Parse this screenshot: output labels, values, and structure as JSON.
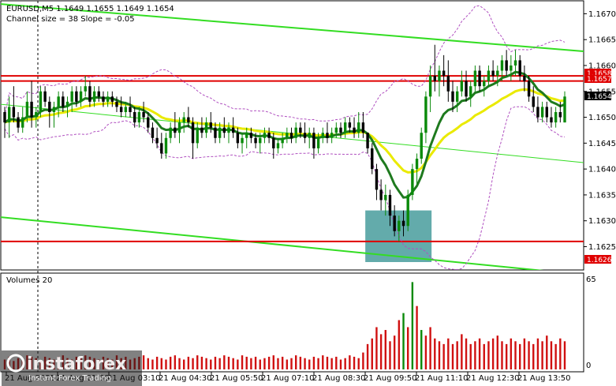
{
  "chart_data": [
    {
      "type": "candlestick",
      "title": "EURUSD,M5  1.1649 1.1655 1.1649 1.1654",
      "subtitle": "Channel size = 38 Slope = -0.05",
      "ylim": [
        1.16205,
        1.16725
      ],
      "y_ticks": [
        1.167,
        1.1665,
        1.166,
        1.1655,
        1.165,
        1.1645,
        1.164,
        1.1635,
        1.163,
        1.1625
      ],
      "x_labels": [
        "21 Aug 2025",
        "21 Aug 01:50",
        "21 Aug 03:10",
        "21 Aug 04:30",
        "21 Aug 05:50",
        "21 Aug 07:10",
        "21 Aug 08:30",
        "21 Aug 09:50",
        "21 Aug 11:10",
        "21 Aug 12:30",
        "21 Aug 13:50"
      ],
      "price_tags": {
        "resistance": "1.1658",
        "mid": "1.1657",
        "current": "1.1654",
        "support": "1.1626"
      },
      "levels": {
        "resistance": 1.1658,
        "mid": 1.1657,
        "support": 1.1626
      },
      "colors": {
        "up": "#0a8a0a",
        "down": "#000000",
        "level": "#e00000",
        "channel": "#33dd22",
        "ma_slow": "#eaea00",
        "ma_fast": "#1e7a1e",
        "band": "#b050c0",
        "highlight": "#3c9696",
        "volume": "#d01010",
        "volume_up": "#0a8a0a"
      },
      "ohlc": [
        [
          1.1651,
          1.1652,
          1.1646,
          1.1649
        ],
        [
          1.1649,
          1.1654,
          1.1646,
          1.1652
        ],
        [
          1.1652,
          1.1656,
          1.1649,
          1.165
        ],
        [
          1.165,
          1.1651,
          1.1647,
          1.1648
        ],
        [
          1.1648,
          1.1652,
          1.1647,
          1.165
        ],
        [
          1.165,
          1.1655,
          1.1649,
          1.1653
        ],
        [
          1.1653,
          1.1657,
          1.1648,
          1.165
        ],
        [
          1.165,
          1.1652,
          1.1648,
          1.1651
        ],
        [
          1.1651,
          1.1656,
          1.165,
          1.1655
        ],
        [
          1.1655,
          1.1656,
          1.1652,
          1.1653
        ],
        [
          1.1653,
          1.1654,
          1.1648,
          1.1651
        ],
        [
          1.1651,
          1.1653,
          1.1648,
          1.1652
        ],
        [
          1.1652,
          1.1655,
          1.165,
          1.1654
        ],
        [
          1.1654,
          1.1655,
          1.1651,
          1.1652
        ],
        [
          1.1652,
          1.1654,
          1.165,
          1.1653
        ],
        [
          1.1653,
          1.1656,
          1.1651,
          1.1655
        ],
        [
          1.1655,
          1.1656,
          1.1652,
          1.1653
        ],
        [
          1.1653,
          1.1656,
          1.1652,
          1.1655
        ],
        [
          1.1655,
          1.1658,
          1.1654,
          1.1656
        ],
        [
          1.1656,
          1.1657,
          1.1652,
          1.1653
        ],
        [
          1.1653,
          1.1656,
          1.1652,
          1.1655
        ],
        [
          1.1655,
          1.1656,
          1.1653,
          1.1654
        ],
        [
          1.1654,
          1.1655,
          1.1652,
          1.1653
        ],
        [
          1.1653,
          1.1655,
          1.1652,
          1.1654
        ],
        [
          1.1654,
          1.1655,
          1.1652,
          1.1653
        ],
        [
          1.1653,
          1.1654,
          1.1651,
          1.1652
        ],
        [
          1.1652,
          1.1654,
          1.165,
          1.1651
        ],
        [
          1.1651,
          1.1653,
          1.165,
          1.1652
        ],
        [
          1.1652,
          1.1654,
          1.165,
          1.1651
        ],
        [
          1.1651,
          1.1652,
          1.1648,
          1.1649
        ],
        [
          1.1649,
          1.1652,
          1.1648,
          1.1651
        ],
        [
          1.1651,
          1.1653,
          1.1649,
          1.165
        ],
        [
          1.165,
          1.1651,
          1.1647,
          1.1648
        ],
        [
          1.1648,
          1.1649,
          1.1645,
          1.1646
        ],
        [
          1.1646,
          1.1648,
          1.1644,
          1.1645
        ],
        [
          1.1645,
          1.1647,
          1.1642,
          1.1643
        ],
        [
          1.1643,
          1.1647,
          1.1642,
          1.1646
        ],
        [
          1.1646,
          1.1649,
          1.1645,
          1.1648
        ],
        [
          1.1648,
          1.1651,
          1.1646,
          1.1647
        ],
        [
          1.1647,
          1.165,
          1.1645,
          1.1649
        ],
        [
          1.1649,
          1.1651,
          1.1647,
          1.165
        ],
        [
          1.165,
          1.1652,
          1.1648,
          1.1649
        ],
        [
          1.1649,
          1.165,
          1.1642,
          1.1645
        ],
        [
          1.1645,
          1.1649,
          1.1644,
          1.1648
        ],
        [
          1.1648,
          1.165,
          1.1646,
          1.1647
        ],
        [
          1.1647,
          1.165,
          1.1646,
          1.1649
        ],
        [
          1.1649,
          1.1651,
          1.1647,
          1.1648
        ],
        [
          1.1648,
          1.1649,
          1.1645,
          1.1646
        ],
        [
          1.1646,
          1.1649,
          1.1645,
          1.1648
        ],
        [
          1.1648,
          1.165,
          1.1646,
          1.1647
        ],
        [
          1.1647,
          1.1649,
          1.1645,
          1.1648
        ],
        [
          1.1648,
          1.165,
          1.1646,
          1.1647
        ],
        [
          1.1647,
          1.1648,
          1.1644,
          1.1645
        ],
        [
          1.1645,
          1.1647,
          1.1643,
          1.1646
        ],
        [
          1.1646,
          1.1648,
          1.1644,
          1.1647
        ],
        [
          1.1647,
          1.1648,
          1.1645,
          1.1646
        ],
        [
          1.1646,
          1.1647,
          1.1644,
          1.1645
        ],
        [
          1.1645,
          1.1647,
          1.1643,
          1.1646
        ],
        [
          1.1646,
          1.1648,
          1.1645,
          1.1647
        ],
        [
          1.1647,
          1.1648,
          1.1645,
          1.1646
        ],
        [
          1.1646,
          1.1647,
          1.1642,
          1.1644
        ],
        [
          1.1644,
          1.1646,
          1.1643,
          1.1645
        ],
        [
          1.1645,
          1.1647,
          1.1644,
          1.1646
        ],
        [
          1.1646,
          1.1648,
          1.1645,
          1.1647
        ],
        [
          1.1647,
          1.1648,
          1.1645,
          1.1646
        ],
        [
          1.1646,
          1.1649,
          1.1645,
          1.1648
        ],
        [
          1.1648,
          1.1649,
          1.1646,
          1.1647
        ],
        [
          1.1647,
          1.1649,
          1.1645,
          1.1646
        ],
        [
          1.1646,
          1.1648,
          1.1644,
          1.1647
        ],
        [
          1.1647,
          1.1648,
          1.1642,
          1.1644
        ],
        [
          1.1644,
          1.1647,
          1.1643,
          1.1646
        ],
        [
          1.1646,
          1.1648,
          1.1645,
          1.1647
        ],
        [
          1.1647,
          1.1649,
          1.1645,
          1.1646
        ],
        [
          1.1646,
          1.1648,
          1.1645,
          1.1647
        ],
        [
          1.1647,
          1.1649,
          1.1646,
          1.1648
        ],
        [
          1.1648,
          1.1649,
          1.1646,
          1.1647
        ],
        [
          1.1647,
          1.165,
          1.1646,
          1.1649
        ],
        [
          1.1649,
          1.165,
          1.1647,
          1.1648
        ],
        [
          1.1648,
          1.165,
          1.1646,
          1.1647
        ],
        [
          1.1647,
          1.1651,
          1.1646,
          1.1649
        ],
        [
          1.1649,
          1.1651,
          1.1646,
          1.1647
        ],
        [
          1.1647,
          1.1646,
          1.1643,
          1.1644
        ],
        [
          1.1644,
          1.1645,
          1.1639,
          1.164
        ],
        [
          1.164,
          1.1641,
          1.1634,
          1.1636
        ],
        [
          1.1636,
          1.1638,
          1.1632,
          1.1634
        ],
        [
          1.1634,
          1.1637,
          1.1631,
          1.1635
        ],
        [
          1.1635,
          1.1636,
          1.1629,
          1.1631
        ],
        [
          1.1631,
          1.1633,
          1.1627,
          1.1628
        ],
        [
          1.1628,
          1.1631,
          1.1626,
          1.163
        ],
        [
          1.163,
          1.1632,
          1.1627,
          1.1629
        ],
        [
          1.1629,
          1.1636,
          1.1628,
          1.1635
        ],
        [
          1.1635,
          1.1641,
          1.1634,
          1.164
        ],
        [
          1.164,
          1.1643,
          1.1637,
          1.1642
        ],
        [
          1.1642,
          1.1648,
          1.1641,
          1.1647
        ],
        [
          1.1647,
          1.1655,
          1.1645,
          1.1654
        ],
        [
          1.1654,
          1.166,
          1.1651,
          1.1658
        ],
        [
          1.1658,
          1.1664,
          1.1655,
          1.1657
        ],
        [
          1.1657,
          1.166,
          1.1654,
          1.1659
        ],
        [
          1.1659,
          1.1662,
          1.1656,
          1.1658
        ],
        [
          1.1658,
          1.1661,
          1.1653,
          1.1655
        ],
        [
          1.1655,
          1.1657,
          1.1651,
          1.1653
        ],
        [
          1.1653,
          1.1656,
          1.1651,
          1.1655
        ],
        [
          1.1655,
          1.1659,
          1.1654,
          1.1657
        ],
        [
          1.1657,
          1.1659,
          1.1653,
          1.1654
        ],
        [
          1.1654,
          1.1657,
          1.1652,
          1.1656
        ],
        [
          1.1656,
          1.166,
          1.1655,
          1.1659
        ],
        [
          1.1659,
          1.166,
          1.1655,
          1.1656
        ],
        [
          1.1656,
          1.1658,
          1.1654,
          1.1657
        ],
        [
          1.1657,
          1.166,
          1.1656,
          1.1659
        ],
        [
          1.1659,
          1.1661,
          1.1657,
          1.1658
        ],
        [
          1.1658,
          1.166,
          1.1656,
          1.1659
        ],
        [
          1.1659,
          1.1662,
          1.1657,
          1.1661
        ],
        [
          1.1661,
          1.1663,
          1.1658,
          1.1659
        ],
        [
          1.1659,
          1.1662,
          1.1657,
          1.166
        ],
        [
          1.166,
          1.1663,
          1.1658,
          1.1661
        ],
        [
          1.1661,
          1.1662,
          1.1657,
          1.1658
        ],
        [
          1.1658,
          1.166,
          1.1655,
          1.1657
        ],
        [
          1.1657,
          1.1658,
          1.1653,
          1.1654
        ],
        [
          1.1654,
          1.1656,
          1.1651,
          1.1652
        ],
        [
          1.1652,
          1.1654,
          1.1649,
          1.165
        ],
        [
          1.165,
          1.1653,
          1.1649,
          1.1652
        ],
        [
          1.1652,
          1.1653,
          1.1649,
          1.165
        ],
        [
          1.165,
          1.1652,
          1.1648,
          1.1649
        ],
        [
          1.1649,
          1.1652,
          1.1648,
          1.1651
        ],
        [
          1.1651,
          1.1653,
          1.1649,
          1.165
        ],
        [
          1.1649,
          1.1655,
          1.1649,
          1.1654
        ]
      ],
      "volumes": [
        7,
        9,
        6,
        8,
        7,
        10,
        9,
        8,
        6,
        9,
        8,
        7,
        9,
        10,
        8,
        7,
        9,
        8,
        10,
        9,
        8,
        7,
        9,
        8,
        7,
        10,
        8,
        9,
        7,
        8,
        9,
        10,
        8,
        7,
        9,
        8,
        7,
        9,
        10,
        8,
        7,
        9,
        8,
        10,
        9,
        8,
        7,
        9,
        8,
        10,
        9,
        8,
        7,
        10,
        9,
        8,
        9,
        7,
        8,
        9,
        10,
        8,
        9,
        7,
        8,
        10,
        9,
        8,
        7,
        9,
        8,
        10,
        9,
        8,
        9,
        7,
        8,
        10,
        9,
        8,
        12,
        18,
        22,
        30,
        25,
        28,
        20,
        24,
        35,
        40,
        30,
        62,
        45,
        28,
        24,
        30,
        22,
        20,
        18,
        22,
        18,
        20,
        25,
        22,
        18,
        20,
        22,
        18,
        20,
        22,
        24,
        20,
        18,
        22,
        20,
        18,
        22,
        20,
        18,
        22,
        20,
        24,
        20,
        18,
        22,
        20
      ]
    }
  ],
  "volume_panel": {
    "title": "Volumes 20",
    "ticks": [
      "65",
      "0"
    ],
    "vmax": 65
  },
  "watermark": {
    "brand": "instaforex",
    "tagline": "Instant Forex Trading"
  }
}
